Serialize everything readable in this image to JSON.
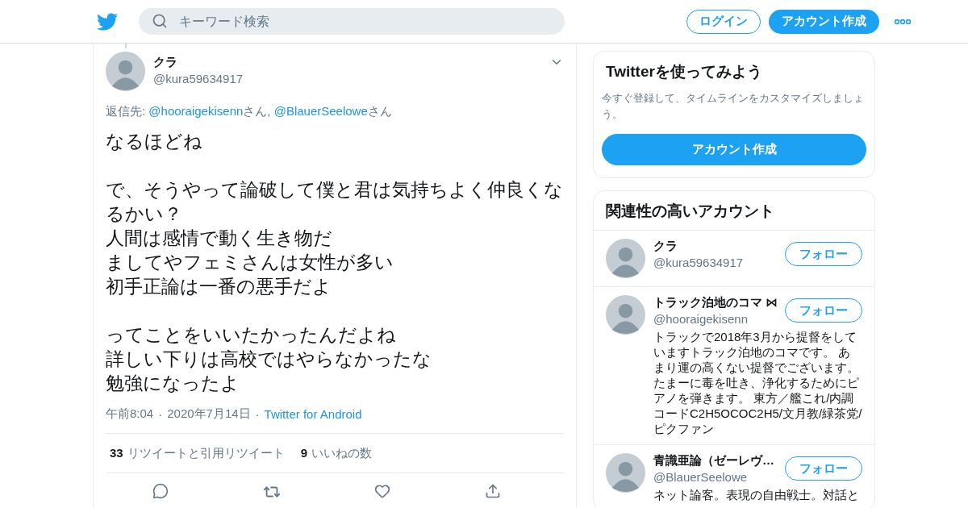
{
  "header": {
    "search": {
      "placeholder": "キーワード検索"
    },
    "login": "ログイン",
    "signup": "アカウント作成"
  },
  "tweet": {
    "name": "クラ",
    "handle": "@kura59634917",
    "reply_line": [
      {
        "kind": "text",
        "text": "返信先: "
      },
      {
        "kind": "link",
        "text": "@hooraigekisenn"
      },
      {
        "kind": "text",
        "text": "さん, "
      },
      {
        "kind": "link",
        "text": "@BlauerSeelowe"
      },
      {
        "kind": "text",
        "text": "さん"
      }
    ],
    "paragraphs": [
      [
        "なるほどね"
      ],
      [
        "で、そうやって論破して僕と君は気持ちよく仲良くなるかい？",
        "人間は感情で動く生き物だ",
        "ましてやフェミさんは女性が多い",
        "初手正論は一番の悪手だよ"
      ],
      [
        "ってことをいいたかったんだよね",
        "詳しい下りは高校ではやらなかったな",
        "勉強になったよ"
      ]
    ],
    "time": "午前8:04",
    "date": "2020年7月14日",
    "separator": "·",
    "source": "Twitter for Android",
    "stats": [
      {
        "count": "33",
        "label": "リツイートと引用リツイート"
      },
      {
        "count": "9",
        "label": "いいねの数"
      }
    ]
  },
  "signup_card": {
    "title": "Twitterを使ってみよう",
    "text": "今すぐ登録して、タイムラインをカスタマイズしましょう。",
    "button": "アカウント作成"
  },
  "related": {
    "title": "関連性の高いアカウント",
    "accounts": [
      {
        "name": "クラ",
        "handle": "@kura59634917",
        "follow": "フォロー"
      },
      {
        "name": "トラック泊地のコマ ⋈",
        "handle": "@hooraigekisenn",
        "follow": "フォロー",
        "bio": "トラックで2018年3月から提督をしていますトラック泊地のコマです。 あまり運の高くない提督でございます。たまーに毒を吐き、浄化するためにピアノを弾きます。 東方／艦これ/内調コードC2H5OCOC2H5/文月教/緑茶党/ピクファン"
      },
      {
        "name": "青識亜論（ゼーレヴ…",
        "handle": "@BlauerSeelowe",
        "follow": "フォロー",
        "bio": "ネット論客。表現の自由戦士。対話と"
      }
    ]
  }
}
